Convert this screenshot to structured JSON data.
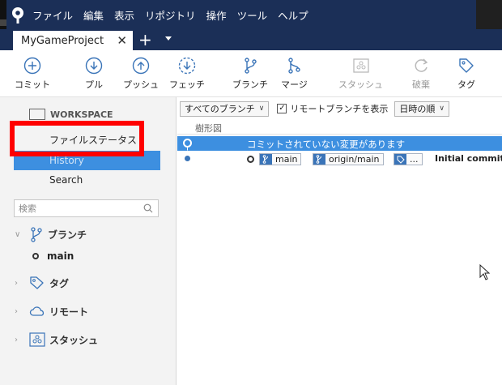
{
  "menu": [
    "ファイル",
    "編集",
    "表示",
    "リポジトリ",
    "操作",
    "ツール",
    "ヘルプ"
  ],
  "tab": {
    "title": "MyGameProject",
    "close": "✕",
    "add": "+"
  },
  "toolbar": {
    "commit": "コミット",
    "pull": "プル",
    "push": "プッシュ",
    "fetch": "フェッチ",
    "branch": "ブランチ",
    "merge": "マージ",
    "stash": "スタッシュ",
    "discard": "破棄",
    "tag": "タグ"
  },
  "sidebar": {
    "workspace": "WORKSPACE",
    "file_status": "ファイルステータス",
    "history": "History",
    "search": "Search",
    "search_placeholder": "検索",
    "branches": "ブランチ",
    "current_branch": "main",
    "tags": "タグ",
    "remotes": "リモート",
    "stashes": "スタッシュ"
  },
  "filter": {
    "branch_select": "すべてのブランチ",
    "show_remote": "リモートブランチを表示",
    "order": "日時の順"
  },
  "columns": {
    "graph": "樹形図"
  },
  "commits": {
    "uncommitted": "コミットされていない変更があります",
    "refs": [
      "main",
      "origin/main",
      "..."
    ],
    "message": "Initial commit"
  },
  "colors": {
    "menubar": "#1b2f57",
    "selection": "#3d8fe0",
    "highlight_box": "#ff0000",
    "ref_icon": "#3a74b8"
  }
}
